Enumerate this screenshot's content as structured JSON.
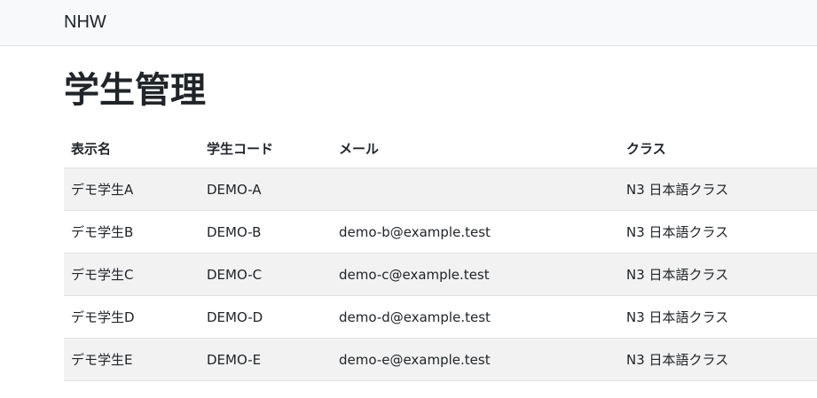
{
  "navbar": {
    "brand": "NHW"
  },
  "page": {
    "title": "学生管理"
  },
  "table": {
    "headers": {
      "display_name": "表示名",
      "student_code": "学生コード",
      "email": "メール",
      "class": "クラス"
    },
    "rows": [
      {
        "display_name": "デモ学生A",
        "student_code": "DEMO-A",
        "email": "",
        "class": "N3 日本語クラス"
      },
      {
        "display_name": "デモ学生B",
        "student_code": "DEMO-B",
        "email": "demo-b@example.test",
        "class": "N3 日本語クラス"
      },
      {
        "display_name": "デモ学生C",
        "student_code": "DEMO-C",
        "email": "demo-c@example.test",
        "class": "N3 日本語クラス"
      },
      {
        "display_name": "デモ学生D",
        "student_code": "DEMO-D",
        "email": "demo-d@example.test",
        "class": "N3 日本語クラス"
      },
      {
        "display_name": "デモ学生E",
        "student_code": "DEMO-E",
        "email": "demo-e@example.test",
        "class": "N3 日本語クラス"
      }
    ]
  }
}
